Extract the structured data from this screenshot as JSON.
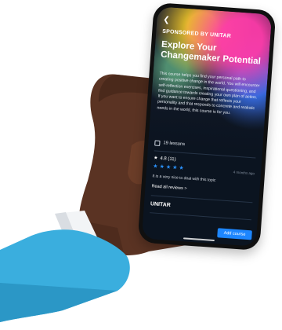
{
  "course": {
    "back_icon": "chevron-left-icon",
    "sponsor": "SPONSORED BY UNITAR",
    "title": "Explore Your Changemaker Potential",
    "description": "This course helps you find your personal path to creating positive change in the world. You will encounter self-reflection exercises, inspirational questioning, and find guidance towards creating your own plan of action. If you want to ensure change that reflects your personality and that responds to concrete and realistic needs in the world, this course is for you.",
    "lessons": "19 lessons",
    "lessons_icon": "list-icon"
  },
  "reviews": {
    "rating_summary": "4.8 (11)",
    "star_count": 5,
    "review_time": "4 months ago",
    "review_text": "It is a very nice to deal with this topic",
    "read_all": "Read all reviews >"
  },
  "provider": {
    "name": "UNITAR"
  },
  "actions": {
    "add_course": "Add course"
  },
  "colors": {
    "accent": "#1d86ff",
    "screen_bg": "#0b1420",
    "skin": "#5a3323",
    "cuff": "#3aaede",
    "sleeve": "#f2f4f6"
  }
}
